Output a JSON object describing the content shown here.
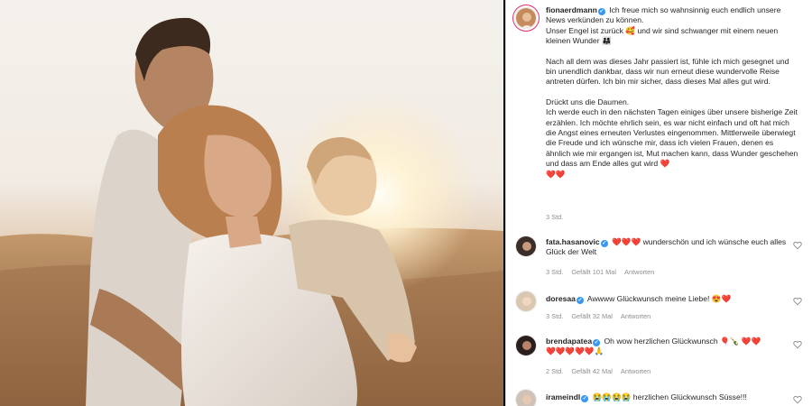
{
  "post": {
    "author": "fionaerdmann",
    "caption_paragraphs": [
      "Ich freue mich so wahnsinnig euch endlich unsere News verkünden zu können.\nUnser Engel ist zurück 🥰 und wir sind schwanger mit einem neuen kleinen Wunder 👨‍👩‍👧",
      "Nach all dem was dieses Jahr passiert ist, fühle ich mich gesegnet und bin unendlich dankbar, dass wir nun erneut diese wundervolle Reise antreten dürfen. Ich bin mir sicher, dass dieses Mal alles gut wird.",
      "Drückt uns die Daumen.\nIch werde euch in den nächsten Tagen einiges über unsere bisherige Zeit erzählen. Ich möchte ehrlich sein, es war nicht einfach und oft hat mich die Angst eines erneuten Verlustes eingenommen. Mittlerweile überwiegt die Freude und ich wünsche mir, dass ich vielen Frauen, denen es ähnlich wie mir ergangen ist, Mut machen kann, dass Wunder geschehen und dass am Ende alles gut wird ❤️\n❤️❤️"
    ],
    "time": "3 Std."
  },
  "comments": [
    {
      "username": "fata.hasanovic",
      "verified": true,
      "text": "❤️❤️❤️ wunderschön und ich wünsche euch alles Glück der Welt",
      "time": "3 Std.",
      "likes": "Gefällt 101 Mal",
      "reply": "Antworten"
    },
    {
      "username": "doresaa",
      "verified": true,
      "text": "Awwww Glückwunsch meine Liebe! 😍❤️",
      "time": "3 Std.",
      "likes": "Gefällt 32 Mal",
      "reply": "Antworten"
    },
    {
      "username": "brendapatea",
      "verified": true,
      "text": "Oh wow herzlichen Glückwunsch 🎈🍾 ❤️❤️\n❤️❤️❤️❤️❤️🙏",
      "time": "2 Std.",
      "likes": "Gefällt 42 Mal",
      "reply": "Antworten"
    },
    {
      "username": "irameindl",
      "verified": true,
      "text": "😭😭😭😭 herzlichen Glückwunsch Süsse!!!",
      "time": "",
      "likes": "",
      "reply": ""
    }
  ],
  "icons": {
    "verified": "verified-badge-icon",
    "like": "heart-outline-icon"
  },
  "colors": {
    "verified": "#3897f0",
    "meta_text": "#8e8e8e",
    "border": "#dbdbdb"
  }
}
